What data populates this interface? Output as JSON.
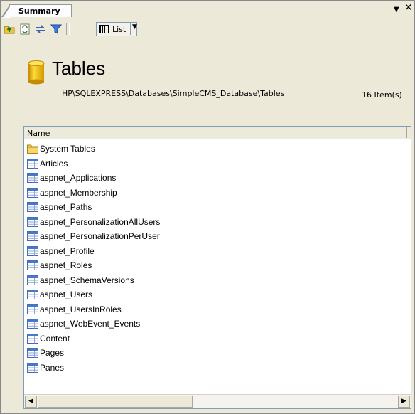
{
  "tab": {
    "label": "Summary"
  },
  "toolbar": {
    "view_label": "List",
    "icons": [
      "up-folder-icon",
      "sync-icon",
      "refresh-icon",
      "filter-icon"
    ]
  },
  "header": {
    "title": "Tables",
    "path": "HP\\SQLEXPRESS\\Databases\\SimpleCMS_Database\\Tables",
    "count": "16 Item(s)"
  },
  "list": {
    "column_name": "Name",
    "items": [
      {
        "label": "System Tables",
        "icon": "folder"
      },
      {
        "label": "Articles",
        "icon": "table"
      },
      {
        "label": "aspnet_Applications",
        "icon": "table"
      },
      {
        "label": "aspnet_Membership",
        "icon": "table"
      },
      {
        "label": "aspnet_Paths",
        "icon": "table"
      },
      {
        "label": "aspnet_PersonalizationAllUsers",
        "icon": "table"
      },
      {
        "label": "aspnet_PersonalizationPerUser",
        "icon": "table"
      },
      {
        "label": "aspnet_Profile",
        "icon": "table"
      },
      {
        "label": "aspnet_Roles",
        "icon": "table"
      },
      {
        "label": "aspnet_SchemaVersions",
        "icon": "table"
      },
      {
        "label": "aspnet_Users",
        "icon": "table"
      },
      {
        "label": "aspnet_UsersInRoles",
        "icon": "table"
      },
      {
        "label": "aspnet_WebEvent_Events",
        "icon": "table"
      },
      {
        "label": "Content",
        "icon": "table"
      },
      {
        "label": "Pages",
        "icon": "table"
      },
      {
        "label": "Panes",
        "icon": "table"
      }
    ]
  },
  "colors": {
    "panel_bg": "#ece9d8",
    "list_border": "#7f9db9",
    "db_icon_yellow": "#f5c400",
    "folder_yellow": "#f0c845",
    "table_blue": "#4a78c8"
  }
}
